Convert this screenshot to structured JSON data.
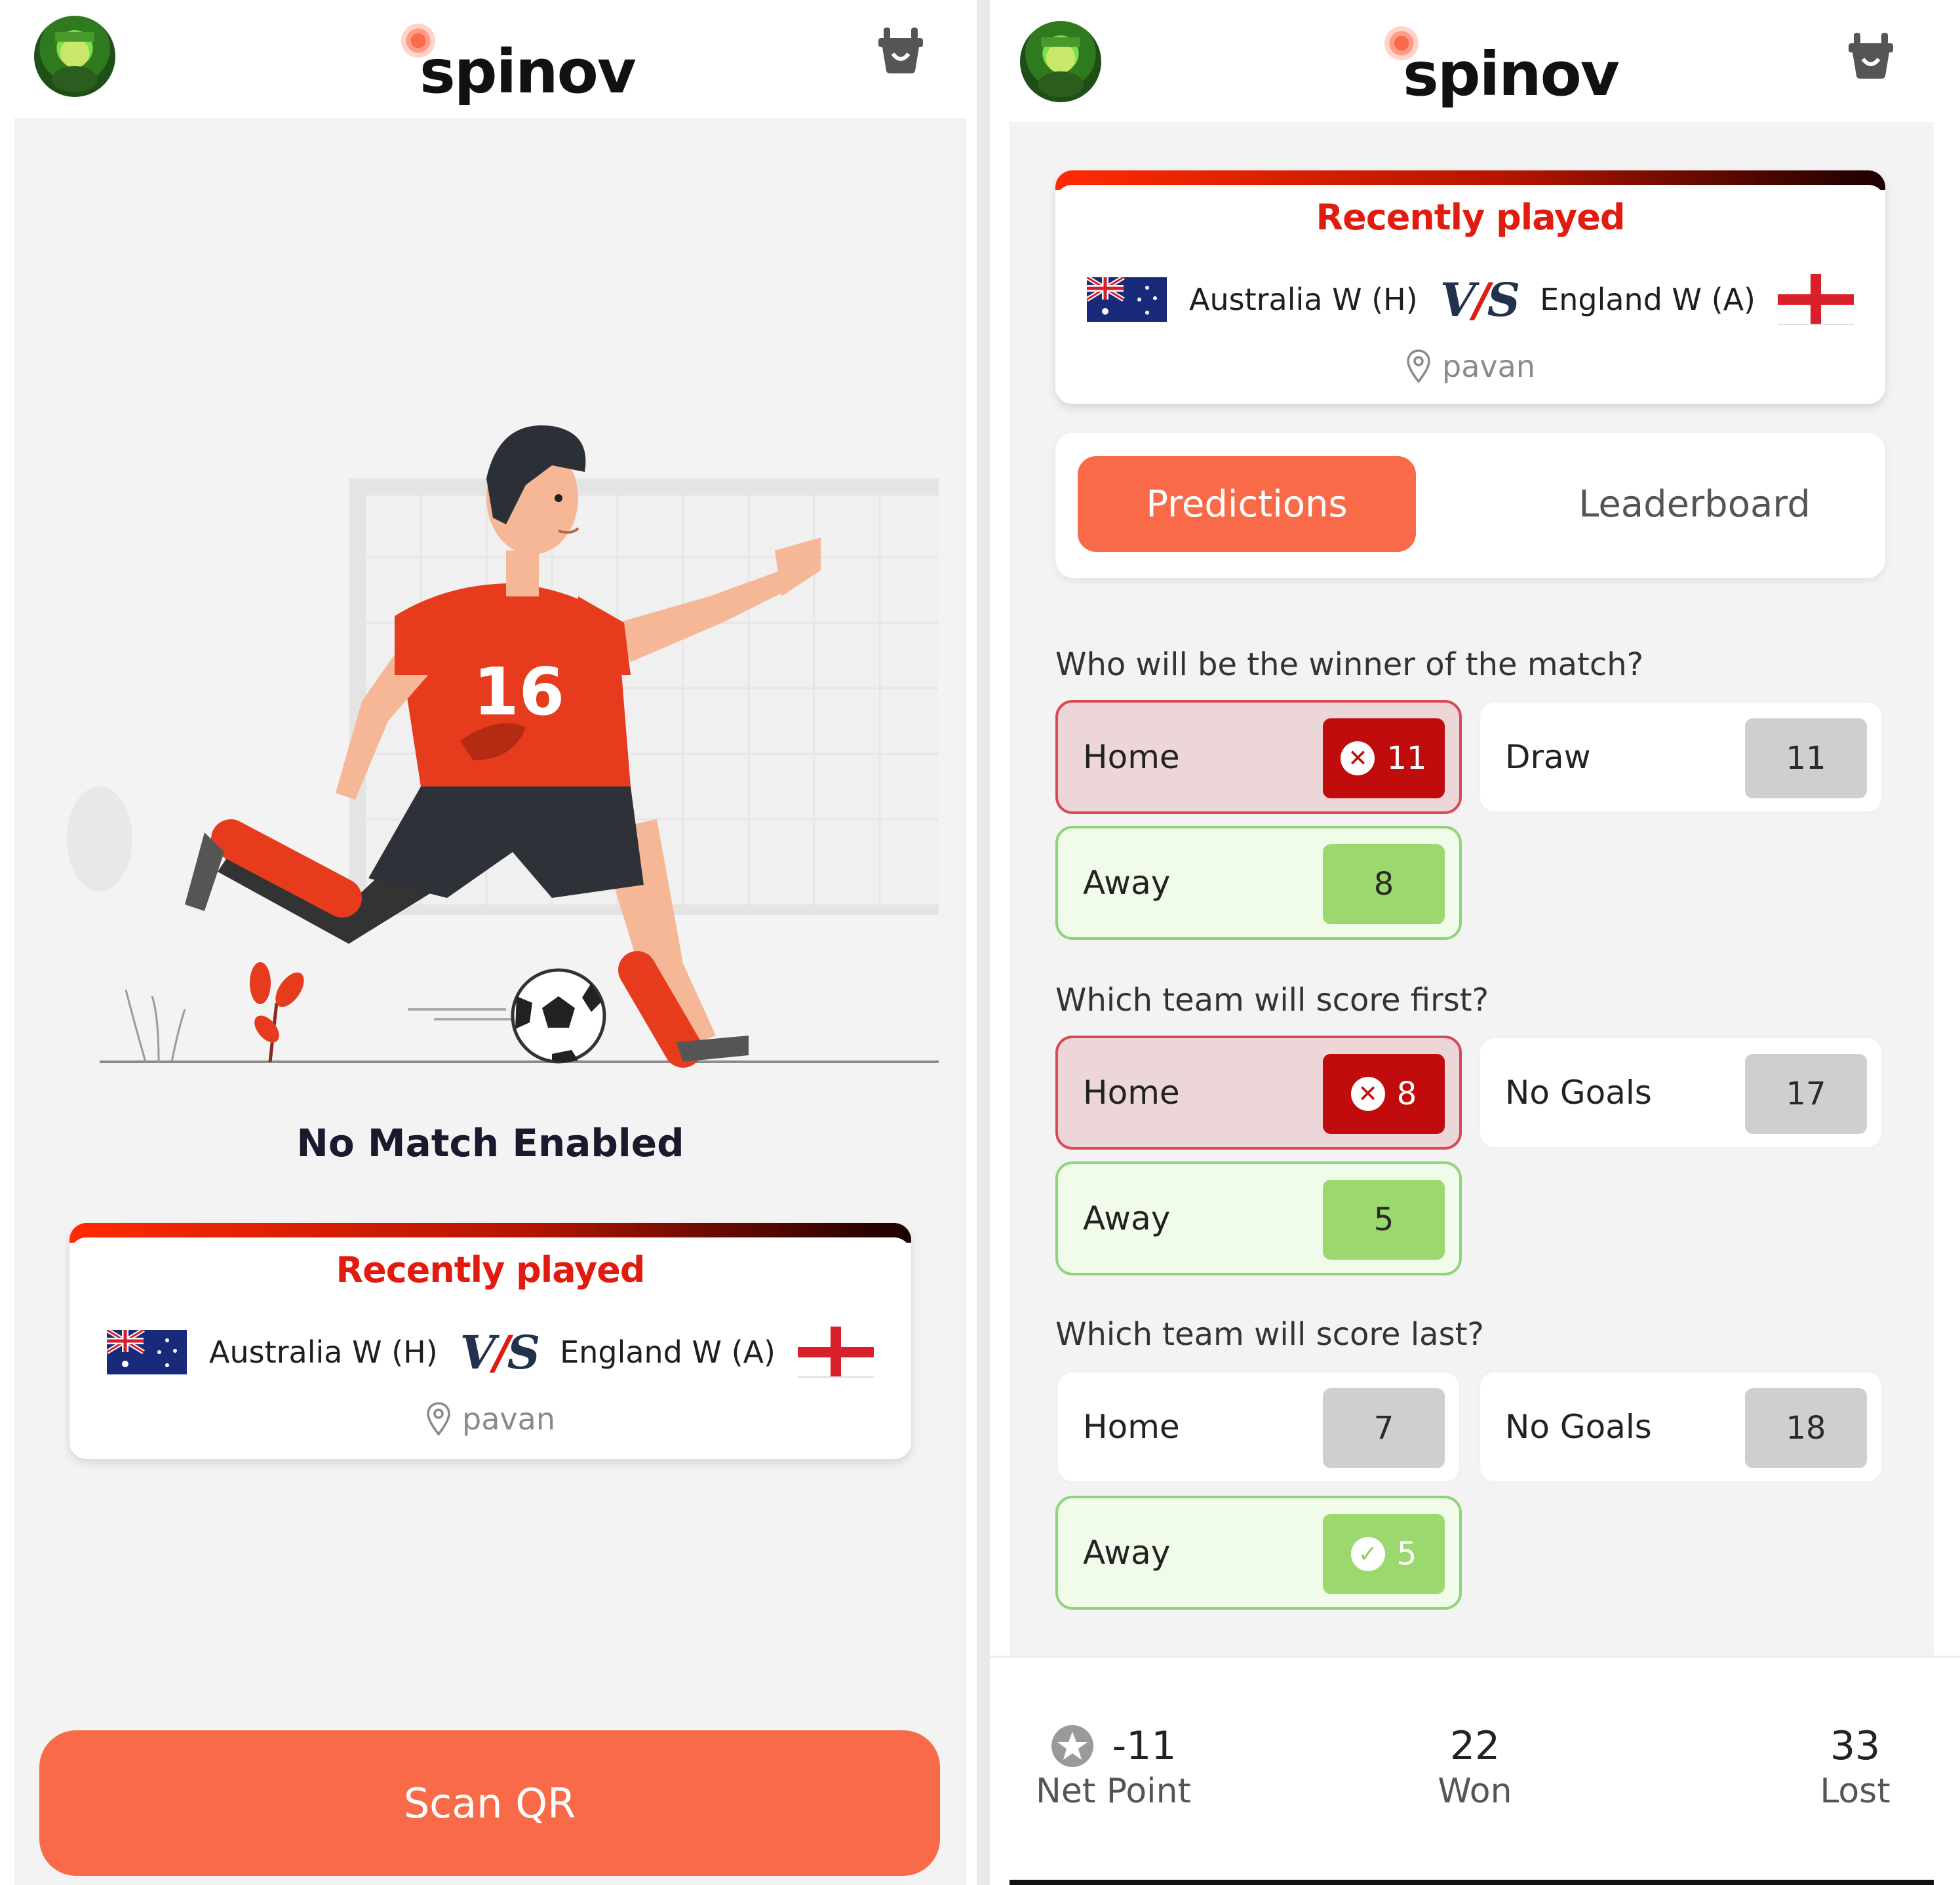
{
  "left": {
    "header": {
      "logo_text": "spinov",
      "avatar": "avatar",
      "cart_icon": "basket-icon"
    },
    "status_message": "No Match Enabled",
    "recent": {
      "title": "Recently played",
      "home_team": "Australia W (H)",
      "vs_prefix": "V",
      "vs_slash": "/",
      "vs_suffix": "S",
      "away_team": "England W (A)",
      "venue": "pavan"
    },
    "scan_button": "Scan QR",
    "illustration": {
      "jersey_number": "16"
    }
  },
  "right": {
    "header": {
      "logo_text": "spinov",
      "avatar": "avatar",
      "cart_icon": "basket-icon"
    },
    "recent": {
      "title": "Recently played",
      "home_team": "Australia W (H)",
      "vs_prefix": "V",
      "vs_slash": "/",
      "vs_suffix": "S",
      "away_team": "England W (A)",
      "venue": "pavan"
    },
    "tabs": {
      "active": "Predictions",
      "inactive": "Leaderboard"
    },
    "questions": [
      {
        "text": "Who will be the winner of the match?",
        "options": [
          {
            "label": "Home",
            "count": "11",
            "state": "wrong"
          },
          {
            "label": "Draw",
            "count": "11",
            "state": "neutral"
          },
          {
            "label": "Away",
            "count": "8",
            "state": "right"
          }
        ]
      },
      {
        "text": "Which team will score first?",
        "options": [
          {
            "label": "Home",
            "count": "8",
            "state": "wrong"
          },
          {
            "label": "No Goals",
            "count": "17",
            "state": "neutral"
          },
          {
            "label": "Away",
            "count": "5",
            "state": "right"
          }
        ]
      },
      {
        "text": "Which team will score last?",
        "options": [
          {
            "label": "Home",
            "count": "7",
            "state": "neutral"
          },
          {
            "label": "No Goals",
            "count": "18",
            "state": "neutral"
          },
          {
            "label": "Away",
            "count": "5",
            "state": "correct"
          }
        ]
      }
    ],
    "stats": {
      "net_point_value": "-11",
      "net_point_label": "Net Point",
      "won_value": "22",
      "won_label": "Won",
      "lost_value": "33",
      "lost_label": "Lost"
    }
  },
  "colors": {
    "accent": "#f96b48",
    "brand_red": "#e01c10",
    "wrong": "#c00c0c",
    "right": "#9bd96f"
  }
}
